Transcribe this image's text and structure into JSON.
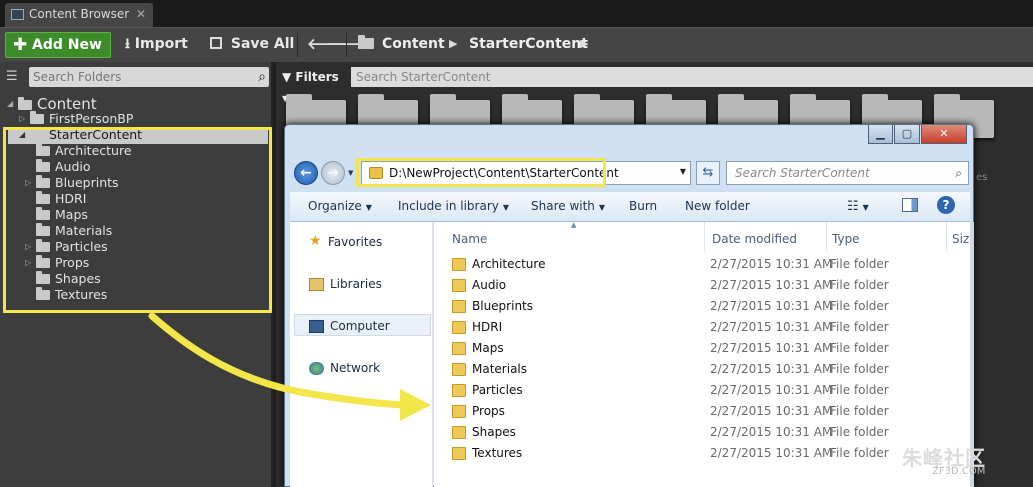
{
  "tab": {
    "title": "Content Browser",
    "close": "✕"
  },
  "toolbar": {
    "add_new": "Add New",
    "import": "Import",
    "save_all": "Save All",
    "breadcrumbs": [
      "Content",
      "StarterContent"
    ]
  },
  "left_panel": {
    "search_placeholder": "Search Folders",
    "tree": [
      {
        "label": "Content",
        "level": 0
      },
      {
        "label": "FirstPersonBP",
        "level": 1,
        "collapsed": true
      },
      {
        "label": "StarterContent",
        "level": 1,
        "selected": true
      },
      {
        "label": "Architecture",
        "level": 2
      },
      {
        "label": "Audio",
        "level": 2
      },
      {
        "label": "Blueprints",
        "level": 2,
        "collapsed": true
      },
      {
        "label": "HDRI",
        "level": 2
      },
      {
        "label": "Maps",
        "level": 2
      },
      {
        "label": "Materials",
        "level": 2
      },
      {
        "label": "Particles",
        "level": 2,
        "collapsed": true
      },
      {
        "label": "Props",
        "level": 2,
        "collapsed": true
      },
      {
        "label": "Shapes",
        "level": 2
      },
      {
        "label": "Textures",
        "level": 2
      }
    ]
  },
  "right_panel": {
    "filters": "Filters",
    "search_placeholder": "Search StarterContent",
    "side_text": "es"
  },
  "explorer": {
    "address": "D:\\NewProject\\Content\\StarterContent",
    "search_placeholder": "Search StarterContent",
    "commands": {
      "organize": "Organize",
      "include": "Include in library",
      "share": "Share with",
      "burn": "Burn",
      "new_folder": "New folder"
    },
    "nav": {
      "favorites": "Favorites",
      "libraries": "Libraries",
      "computer": "Computer",
      "network": "Network"
    },
    "columns": {
      "name": "Name",
      "date": "Date modified",
      "type": "Type",
      "size": "Size"
    },
    "files": [
      {
        "name": "Architecture",
        "date": "2/27/2015 10:31 AM",
        "type": "File folder"
      },
      {
        "name": "Audio",
        "date": "2/27/2015 10:31 AM",
        "type": "File folder"
      },
      {
        "name": "Blueprints",
        "date": "2/27/2015 10:31 AM",
        "type": "File folder"
      },
      {
        "name": "HDRI",
        "date": "2/27/2015 10:31 AM",
        "type": "File folder"
      },
      {
        "name": "Maps",
        "date": "2/27/2015 10:31 AM",
        "type": "File folder"
      },
      {
        "name": "Materials",
        "date": "2/27/2015 10:31 AM",
        "type": "File folder"
      },
      {
        "name": "Particles",
        "date": "2/27/2015 10:31 AM",
        "type": "File folder"
      },
      {
        "name": "Props",
        "date": "2/27/2015 10:31 AM",
        "type": "File folder"
      },
      {
        "name": "Shapes",
        "date": "2/27/2015 10:31 AM",
        "type": "File folder"
      },
      {
        "name": "Textures",
        "date": "2/27/2015 10:31 AM",
        "type": "File folder"
      }
    ]
  },
  "watermark": {
    "text": "朱峰社区",
    "sub": "ZF3D.COM"
  },
  "colors": {
    "highlight": "#f3e64a",
    "ue_green": "#3c8c2a",
    "explorer_frame": "#cfe0f3"
  }
}
